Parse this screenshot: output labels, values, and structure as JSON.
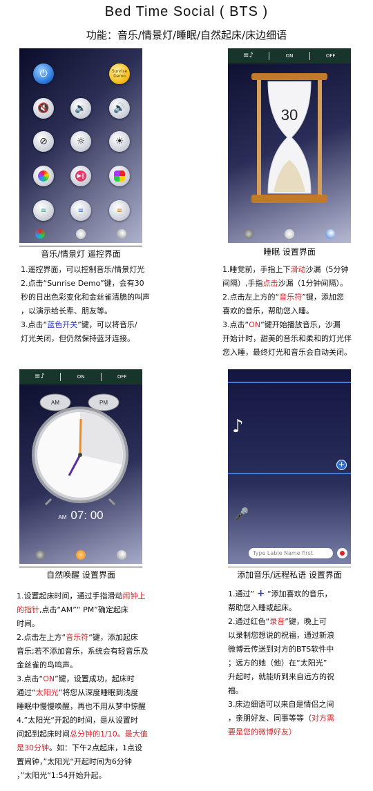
{
  "title": "Bed  Time  Social ( BTS )",
  "subtitle": "功能：音乐/情景灯/睡眠/自然起床/床边细语",
  "panel_remote": {
    "sunrise_button": "Sunrise Demo",
    "caption": "音乐/情景灯 遥控界面",
    "desc": [
      "1.遥控界面，可以控制音乐/情景灯光",
      "2.点击“Sunrise Demo”键，会有30",
      "秒的日出色彩变化和金丝雀清脆的叫声",
      "，以演示给长辈、朋友等。",
      "3.点击“",
      "蓝色开关",
      "”键，可以将音乐/",
      "灯光关闭，但仍然保持蓝牙连接。"
    ]
  },
  "panel_sleep": {
    "topbar": [
      "ON",
      "OFF"
    ],
    "hourglass_value": "30",
    "caption": "睡眠  设置界面",
    "desc": {
      "l1a": "1.睡觉前，手指上下",
      "l1b": "滑动",
      "l1c": "沙漏（5分钟",
      "l2a": "间隔）,手指",
      "l2b": "点击",
      "l2c": "沙漏（1分钟间隔）。",
      "l3a": "2.点击左上方的“",
      "l3b": "音乐符",
      "l3c": "”键，添加您",
      "l4": "喜欢的音乐，帮助您入睡。",
      "l5a": "3.点击“",
      "l5b": "ON",
      "l5c": "”键开始播放音乐，沙漏",
      "l6": "开始计时，甜美的音乐和柔和的灯光伴",
      "l7": "您入睡，最终灯光和音乐会自动关闭。"
    }
  },
  "panel_wake": {
    "topbar": [
      "ON",
      "OFF"
    ],
    "bell_left": "AM",
    "bell_right": "PM",
    "ampm": "AM",
    "time": "07: 00",
    "caption": "自然唤醒  设置界面",
    "desc": {
      "l1a": "1.设置起床时间，通过手指滑动",
      "l1b": "闹钟上",
      "l2a": "的指针",
      "l2b": ",点击“AM”“ PM”确定起床",
      "l3": "时间。",
      "l4a": "2.点击左上方“",
      "l4b": "音乐符",
      "l4c": "“键，添加起床",
      "l5": "音乐;若不添加音乐，系统会有轻音乐及",
      "l6": "金丝雀的鸟鸣声。",
      "l7a": "3.点击“",
      "l7b": "ON",
      "l7c": "”键，设置成功，起床时",
      "l8a": "通过“",
      "l8b": "太阳光",
      "l8c": "”将您从深度睡眠到浅度",
      "l9": "睡眠中慢慢唤醒，再也不用从梦中惊醒",
      "l10": "4.”太阳光“开起的时间，是从设置时",
      "l11a": "间起到起床时间",
      "l11b": "总分钟的1/10。最大值",
      "l12a": "是30分钟",
      "l12b": "。如：下午2点起床，1点设",
      "l13": "置闹钟，”太阳光“开起时间为6分钟",
      "l14": "，”太阳光“1:54开始升起。"
    }
  },
  "panel_whisper": {
    "input_placeholder": "Type Lable Name first",
    "caption": "添加音乐/远程私语  设置界面",
    "desc": {
      "l1a": "1.通过”",
      "l1b": "+",
      "l1c": "“添加喜欢的音乐，",
      "l2": "帮助您入睡或起床。",
      "l3a": "2.通过红色“",
      "l3b": "录音",
      "l3c": "”键，晚上可",
      "l4": "以录制您想说的祝福，通过新浪",
      "l5": "微博云传送到对方的BTS软件中",
      "l6": "；远方的她（他）在“太阳光”",
      "l7": "升起时，就能听到来自远方的祝",
      "l8": "福。",
      "l9": "3.床边细语可以来自是情侣之间",
      "l10a": "，亲朋好友、同事等等（",
      "l10b": "对方需",
      "l11": "要是您的微博好友）"
    }
  },
  "colors": {
    "accent_red": "#d8252b",
    "accent_blue": "#2a39c8"
  }
}
